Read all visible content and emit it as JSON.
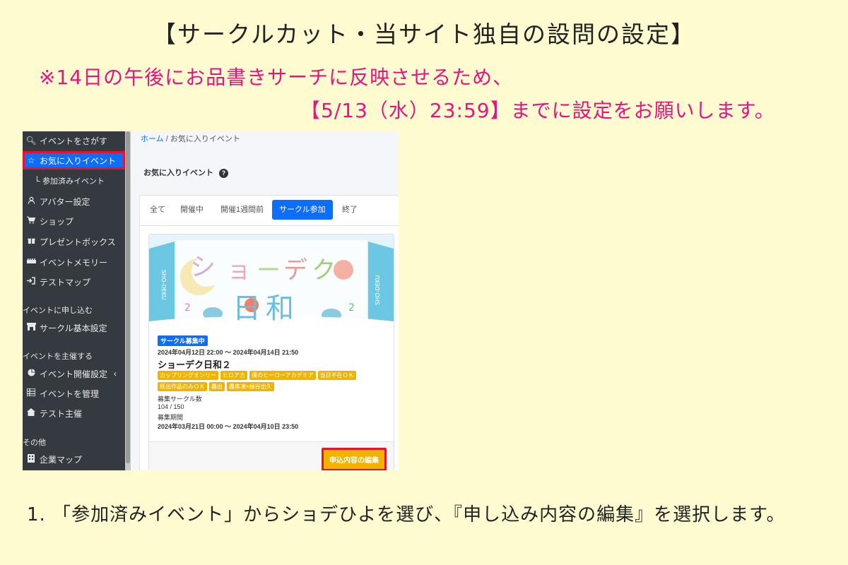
{
  "heading": {
    "title": "【サークルカット・当サイト独自の設問の設定】",
    "note_line1": "※14日の午後にお品書きサーチに反映させるため、",
    "note_line2": "【5/13（水）23:59】までに設定をお願いします。"
  },
  "sidebar": {
    "items": [
      {
        "icon": "search-icon",
        "label": "イベントをさがす"
      },
      {
        "icon": "star-icon",
        "label": "お気に入りイベント",
        "active": true
      },
      {
        "icon": "sub-arrow-icon",
        "label": "参加済みイベント"
      },
      {
        "icon": "user-icon",
        "label": "アバター設定"
      },
      {
        "icon": "cart-icon",
        "label": "ショップ"
      },
      {
        "icon": "gift-icon",
        "label": "プレゼントボックス"
      },
      {
        "icon": "memory-icon",
        "label": "イベントメモリー"
      },
      {
        "icon": "enter-icon",
        "label": "テストマップ"
      }
    ],
    "section_apply": "イベントに申し込む",
    "apply_items": [
      {
        "icon": "store-icon",
        "label": "サークル基本設定"
      }
    ],
    "section_host": "イベントを主催する",
    "host_items": [
      {
        "icon": "pie-icon",
        "label": "イベント開催設定"
      },
      {
        "icon": "list-icon",
        "label": "イベントを管理"
      },
      {
        "icon": "home-icon",
        "label": "テスト主催"
      }
    ],
    "section_other": "その他",
    "other_items": [
      {
        "icon": "building-icon",
        "label": "企業マップ"
      }
    ]
  },
  "breadcrumb": {
    "home": "ホーム",
    "separator": "/",
    "current": "お気に入りイベント"
  },
  "page_title": "お気に入りイベント",
  "help_glyph": "?",
  "tabs": [
    "全て",
    "開催中",
    "開催1週間前",
    "サークル参加",
    "終了"
  ],
  "active_tab": "サークル参加",
  "event": {
    "banner_title": "ショーデク日和",
    "banner_side_text": "SHO-DEKU",
    "banner_number": "2",
    "status_badge": "サークル募集中",
    "period": "2024年04月12日 22:00 ～ 2024年04月14日 21:50",
    "title": "ショーデク日和２",
    "tags": [
      "カップリングオンリー",
      "ヒロアカ",
      "僕のヒーローアカデミア",
      "当日不在ＯＫ",
      "既出作品のみＯＫ",
      "轟出",
      "轟焦凍×緑谷出久"
    ],
    "recruit_label": "募集サークル数",
    "recruit_count": "104 / 150",
    "recruit_period_label": "募集期間",
    "recruit_period": "2024年03月21日 00:00 ～ 2024年04月10日 23:50",
    "edit_button": "申込内容の編集"
  },
  "instruction": "1. 「参加済みイベント」からショデひよを選び、『申し込み内容の編集』を選択します。",
  "colors": {
    "background": "#fdfbcf",
    "note": "#e5157f",
    "highlight_box": "#e8132a",
    "active_blue": "#0d6efd",
    "tag_yellow": "#f0b400",
    "sidebar": "#343a40"
  }
}
